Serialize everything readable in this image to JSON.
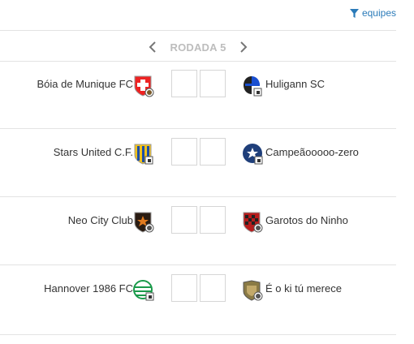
{
  "filter": {
    "label": "equipes",
    "icon": "filter-icon"
  },
  "round": {
    "label": "RODADA 5",
    "prev_icon": "chevron-left-icon",
    "next_icon": "chevron-right-icon"
  },
  "matches": [
    {
      "home": "Bóia de Munique FC",
      "away": "Huligann SC",
      "home_score": "",
      "away_score": ""
    },
    {
      "home": "Stars United C.F.",
      "away": "Campeãooooo-zero",
      "home_score": "",
      "away_score": ""
    },
    {
      "home": "Neo City Club",
      "away": "Garotos do Ninho",
      "home_score": "",
      "away_score": ""
    },
    {
      "home": "Hannover 1986 FC",
      "away": "É o ki tú merece",
      "home_score": "",
      "away_score": ""
    }
  ]
}
